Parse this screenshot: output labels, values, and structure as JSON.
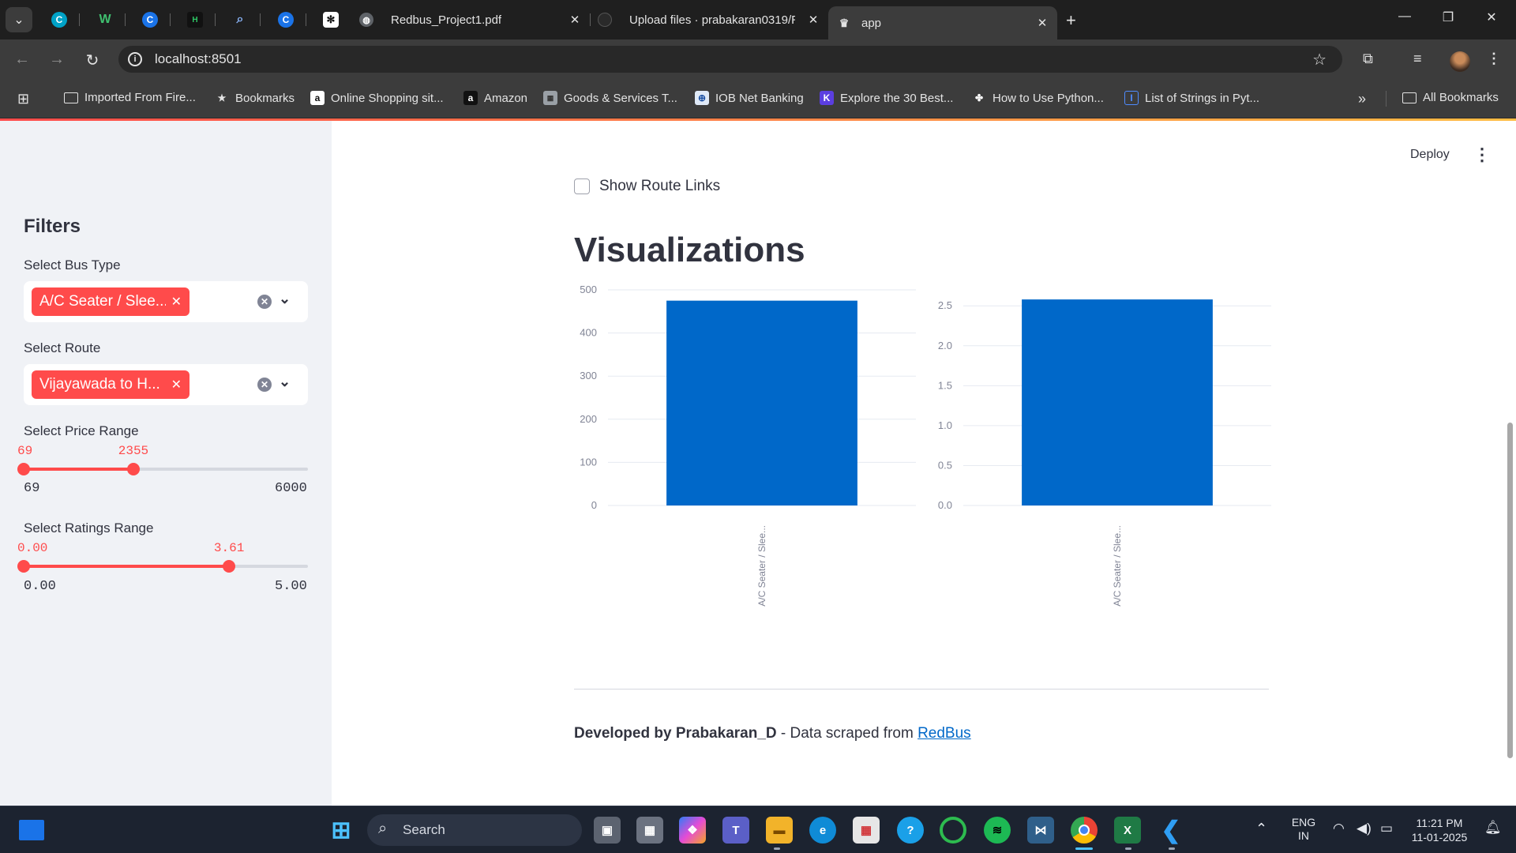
{
  "browser": {
    "tabs": [
      {
        "title": "Redbus_Project1.pdf"
      },
      {
        "title": "Upload files · prabakaran0319/R"
      },
      {
        "title": "app"
      }
    ],
    "url": "localhost:8501",
    "bookmarks": [
      {
        "label": "Imported From Fire...",
        "icon": "folder-icon"
      },
      {
        "label": "Bookmarks",
        "icon": "star-icon"
      },
      {
        "label": "Online Shopping sit...",
        "icon": "amazon-a-icon"
      },
      {
        "label": "Amazon",
        "icon": "amazon-icon"
      },
      {
        "label": "Goods & Services T...",
        "icon": "gst-icon"
      },
      {
        "label": "IOB Net Banking",
        "icon": "bank-icon"
      },
      {
        "label": "Explore the 30 Best...",
        "icon": "k-icon"
      },
      {
        "label": "How to Use Python...",
        "icon": "python-icon"
      },
      {
        "label": "List of Strings in Pyt...",
        "icon": "list-icon"
      }
    ],
    "all_bookmarks": "All Bookmarks"
  },
  "app": {
    "deploy": "Deploy",
    "sidebar": {
      "title": "Filters",
      "bus_type": {
        "label": "Select Bus Type",
        "chip": "A/C Seater / Slee..."
      },
      "route": {
        "label": "Select Route",
        "chip": "Vijayawada to H..."
      },
      "price": {
        "label": "Select Price Range",
        "low": "69",
        "high": "2355",
        "min": "69",
        "max": "6000",
        "low_value": 69,
        "high_value": 2355,
        "range_min": 69,
        "range_max": 6000
      },
      "ratings": {
        "label": "Select Ratings Range",
        "low": "0.00",
        "high": "3.61",
        "min": "0.00",
        "max": "5.00",
        "low_value": 0,
        "high_value": 3.61,
        "range_min": 0,
        "range_max": 5
      }
    },
    "checkbox": {
      "label": "Show Route Links",
      "checked": false
    },
    "section_title": "Visualizations",
    "footer": {
      "author": "Developed by Prabakaran_D",
      "text": " - Data scraped from ",
      "link": "RedBus"
    }
  },
  "chart_data": [
    {
      "type": "bar",
      "categories": [
        "A/C Seater / Slee..."
      ],
      "values": [
        475
      ],
      "ylim": [
        0,
        500
      ],
      "yticks": [
        0,
        100,
        200,
        300,
        400,
        500
      ],
      "color": "#0068c9",
      "grid": true
    },
    {
      "type": "bar",
      "categories": [
        "A/C Seater / Slee..."
      ],
      "values": [
        2.58
      ],
      "ylim": [
        0,
        2.7
      ],
      "yticks": [
        "0.0",
        "0.5",
        "1.0",
        "1.5",
        "2.0",
        "2.5"
      ],
      "color": "#0068c9",
      "grid": true
    }
  ],
  "taskbar": {
    "search": "Search",
    "lang": "ENG",
    "region": "IN",
    "time": "11:21 PM",
    "date": "11-01-2025"
  }
}
